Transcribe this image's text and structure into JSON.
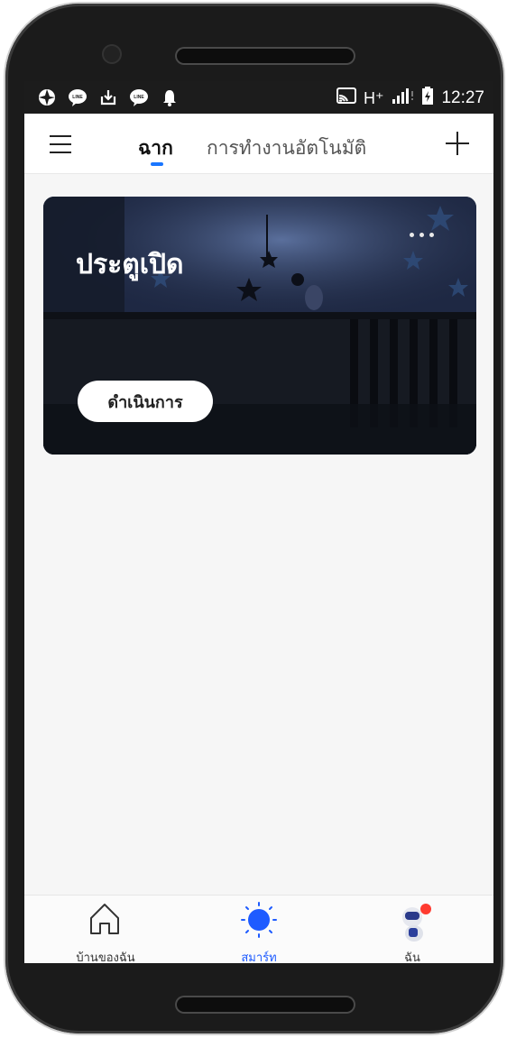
{
  "status_bar": {
    "left_icons": [
      "aperture-icon",
      "line-app-icon",
      "download-icon",
      "line-app-icon",
      "bell-icon"
    ],
    "right_icons": [
      "cast-icon",
      "signal-icon",
      "battery-icon"
    ],
    "network": "H⁺",
    "time": "12:27"
  },
  "app_bar": {
    "tabs": [
      {
        "label": "ฉาก",
        "active": true
      },
      {
        "label": "การทำงานอัตโนมัติ",
        "active": false
      }
    ]
  },
  "scene_card": {
    "title": "ประตูเปิด",
    "action_label": "ดำเนินการ"
  },
  "bottom_nav": {
    "items": [
      {
        "label": "บ้านของฉัน",
        "icon": "home-icon",
        "active": false
      },
      {
        "label": "สมาร์ท",
        "icon": "sun-icon",
        "active": true
      },
      {
        "label": "ฉัน",
        "icon": "profile-avatar-icon",
        "active": false
      }
    ]
  },
  "colors": {
    "accent": "#1976ff",
    "active_nav": "#1e5bff",
    "status_bar": "#1c1c1c",
    "background": "#f6f6f6"
  }
}
